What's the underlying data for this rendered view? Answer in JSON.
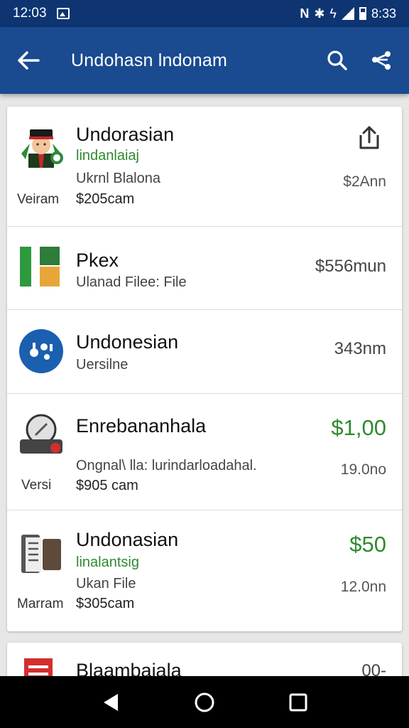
{
  "status_bar": {
    "time_left": "12:03",
    "time_right": "8:33",
    "network_letter": "N"
  },
  "app_bar": {
    "title": "Undohasn lndonam"
  },
  "items": [
    {
      "name": "Undorasian",
      "subtitle": "lindanlaiaj",
      "detail": "Ukrnl Blalona",
      "price": "$205cam",
      "version_label": "Veiram",
      "size": "$2Ann"
    },
    {
      "name": "Pkex",
      "detail": "Ulanad Filee: File",
      "size": "$556mun"
    },
    {
      "name": "Undonesian",
      "detail": "Uersilne",
      "size": "343nm"
    },
    {
      "name": "Enrebananhala",
      "detail": "Ongnal\\ lla: lurindarloadahal.",
      "price": "$905 cam",
      "version_label": "Versi",
      "cost": "$1,00",
      "size": "19.0no"
    },
    {
      "name": "Undonasian",
      "subtitle": "linalantsig",
      "detail": "Ukan File",
      "price": "$305cam",
      "version_label": "Marram",
      "cost": "$50",
      "size": "12.0nn"
    },
    {
      "name": "Blaambaiala",
      "size": "00-"
    }
  ],
  "colors": {
    "status_bar": "#0e3572",
    "app_bar": "#1a4a8f",
    "accent_green": "#2e8a2e",
    "background": "#e7e7e7"
  },
  "icons": [
    "back-arrow-icon",
    "search-icon",
    "share-network-icon",
    "upload-share-icon",
    "nav-back-icon",
    "nav-home-icon",
    "nav-recents-icon"
  ]
}
